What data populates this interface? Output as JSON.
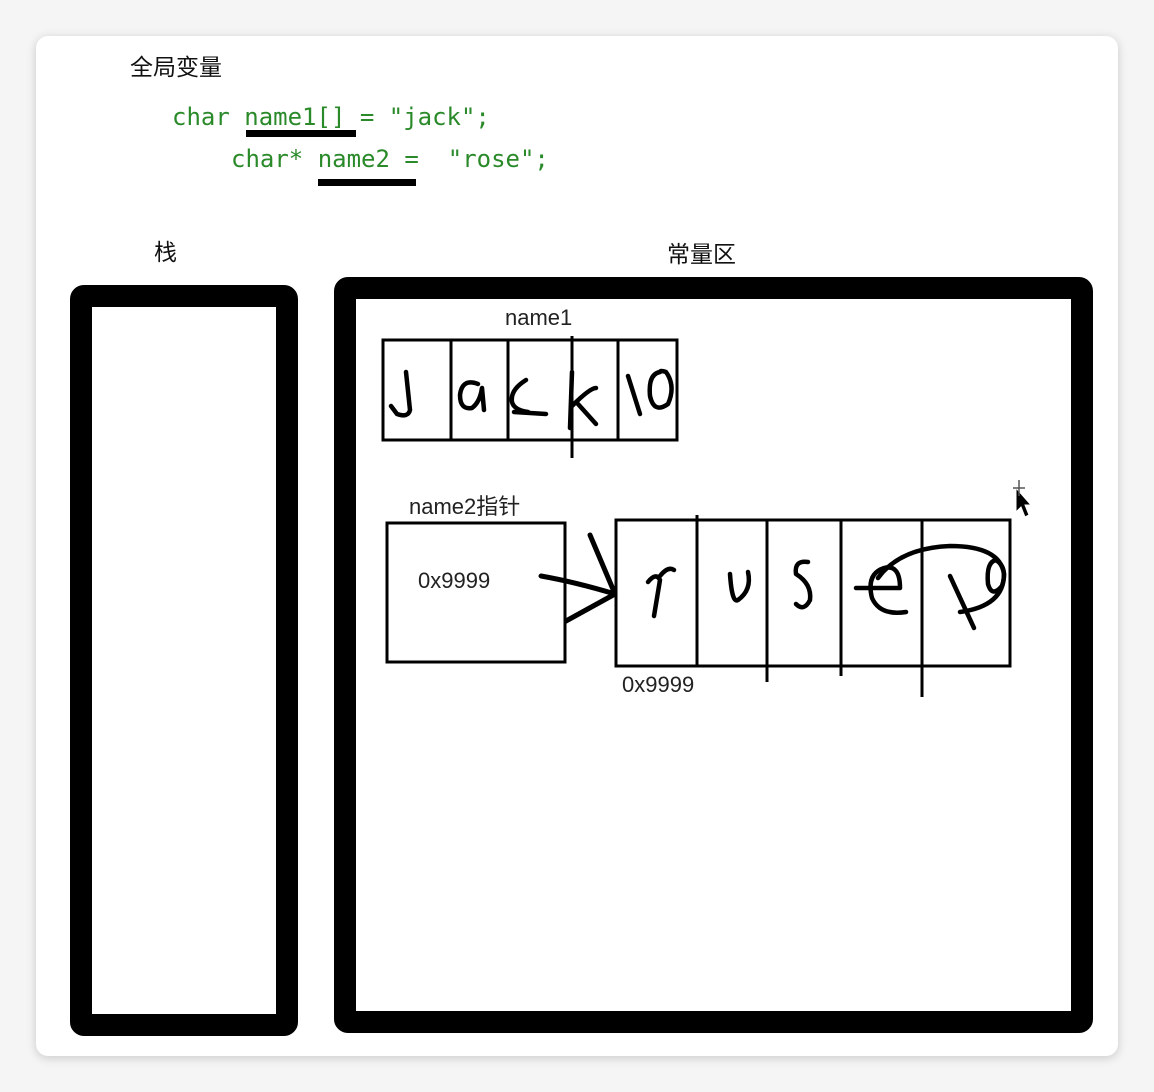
{
  "global_label": "全局变量",
  "code": {
    "line1": "char name1[] = \"jack\";",
    "line2": "char* name2 =  \"rose\";"
  },
  "stack_label": "栈",
  "constant_label": "常量区",
  "name1": {
    "label": "name1",
    "cells": [
      "J",
      "a",
      "c",
      "k",
      "\\0"
    ]
  },
  "name2": {
    "pointer_label": "name2指针",
    "pointer_value": "0x9999",
    "cells": [
      "r",
      "o",
      "s",
      "e",
      "\\0"
    ],
    "address_label": "0x9999"
  }
}
